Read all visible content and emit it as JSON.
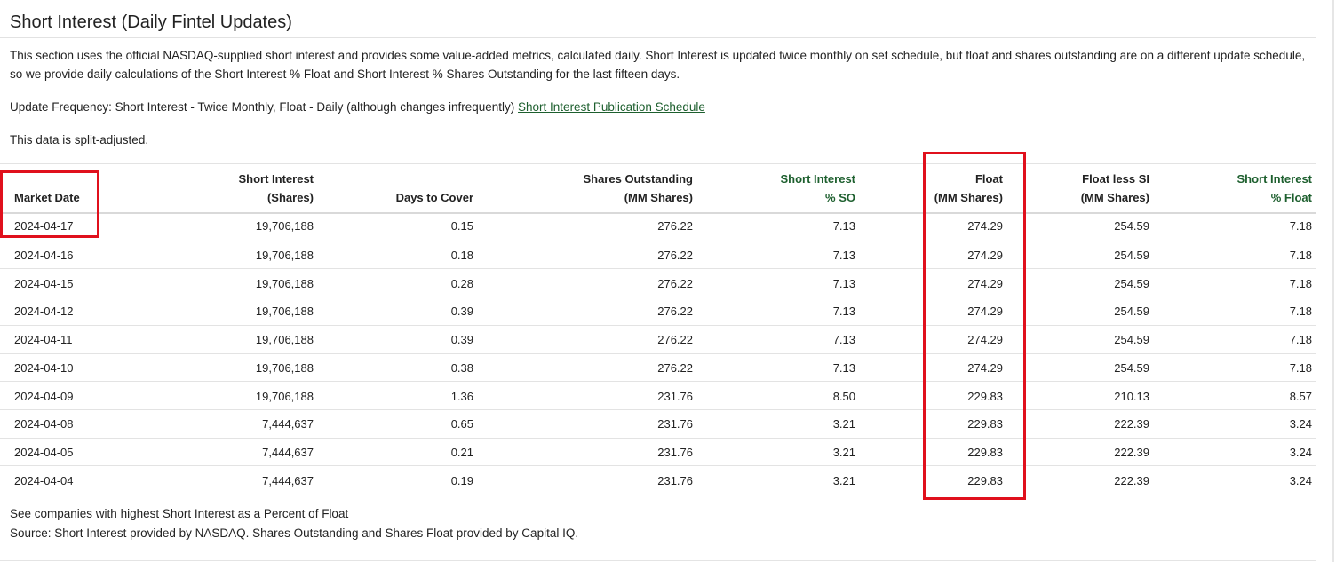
{
  "section": {
    "title": "Short Interest (Daily Fintel Updates)",
    "description": "This section uses the official NASDAQ-supplied short interest and provides some value-added metrics, calculated daily. Short Interest is updated twice monthly on set schedule, but float and shares outstanding are on a different update schedule, so we provide daily calculations of the Short Interest % Float and Short Interest % Shares Outstanding for the last fifteen days.",
    "update_frequency_text": "Update Frequency: Short Interest - Twice Monthly, Float - Daily (although changes infrequently) ",
    "schedule_link": "Short Interest Publication Schedule",
    "split_note": "This data is split-adjusted."
  },
  "table": {
    "headers": [
      {
        "line1": "",
        "line2": "Market Date",
        "green": false
      },
      {
        "line1": "Short Interest",
        "line2": "(Shares)",
        "green": false
      },
      {
        "line1": "",
        "line2": "Days to Cover",
        "green": false
      },
      {
        "line1": "Shares Outstanding",
        "line2": "(MM Shares)",
        "green": false
      },
      {
        "line1": "Short Interest",
        "line2": "% SO",
        "green": true
      },
      {
        "line1": "Float",
        "line2": "(MM Shares)",
        "green": false
      },
      {
        "line1": "Float less SI",
        "line2": "(MM Shares)",
        "green": false
      },
      {
        "line1": "Short Interest",
        "line2": "% Float",
        "green": true
      }
    ],
    "rows": [
      [
        "2024-04-17",
        "19,706,188",
        "0.15",
        "276.22",
        "7.13",
        "274.29",
        "254.59",
        "7.18"
      ],
      [
        "2024-04-16",
        "19,706,188",
        "0.18",
        "276.22",
        "7.13",
        "274.29",
        "254.59",
        "7.18"
      ],
      [
        "2024-04-15",
        "19,706,188",
        "0.28",
        "276.22",
        "7.13",
        "274.29",
        "254.59",
        "7.18"
      ],
      [
        "2024-04-12",
        "19,706,188",
        "0.39",
        "276.22",
        "7.13",
        "274.29",
        "254.59",
        "7.18"
      ],
      [
        "2024-04-11",
        "19,706,188",
        "0.39",
        "276.22",
        "7.13",
        "274.29",
        "254.59",
        "7.18"
      ],
      [
        "2024-04-10",
        "19,706,188",
        "0.38",
        "276.22",
        "7.13",
        "274.29",
        "254.59",
        "7.18"
      ],
      [
        "2024-04-09",
        "19,706,188",
        "1.36",
        "231.76",
        "8.50",
        "229.83",
        "210.13",
        "8.57"
      ],
      [
        "2024-04-08",
        "7,444,637",
        "0.65",
        "231.76",
        "3.21",
        "229.83",
        "222.39",
        "3.24"
      ],
      [
        "2024-04-05",
        "7,444,637",
        "0.21",
        "231.76",
        "3.21",
        "229.83",
        "222.39",
        "3.24"
      ],
      [
        "2024-04-04",
        "7,444,637",
        "0.19",
        "231.76",
        "3.21",
        "229.83",
        "222.39",
        "3.24"
      ]
    ]
  },
  "footer": {
    "line1": "See companies with highest Short Interest as a Percent of Float",
    "line2": "Source: Short Interest provided by NASDAQ. Shares Outstanding and Shares Float provided by Capital IQ."
  },
  "colors": {
    "accent_green": "#1d5f2e",
    "highlight_red": "#e0101c"
  }
}
